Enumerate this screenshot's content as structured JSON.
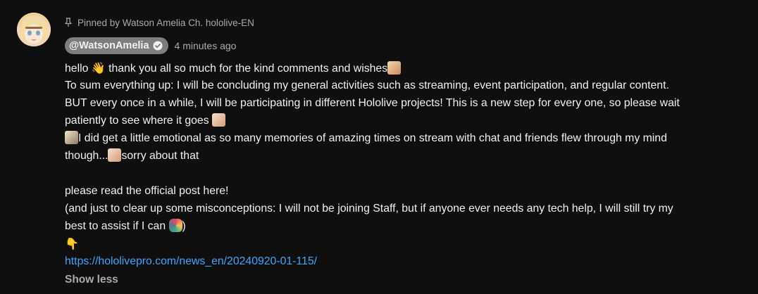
{
  "comment": {
    "pinned_label": "Pinned by Watson Amelia Ch. hololive-EN",
    "author_handle": "@WatsonAmelia",
    "timestamp": "4 minutes ago",
    "lines": [
      {
        "segments": [
          "hello ",
          "👋",
          " thank you all so much for the kind comments and wishes"
        ]
      },
      {
        "text": "To sum everything up: I will be concluding my general activities such as streaming, event participation, and regular content."
      },
      {
        "text": "BUT every once in a while, I will be participating in different Hololive projects! This is a new step for every one, so please wait"
      },
      {
        "text": "patiently to see where it goes "
      },
      {
        "text": "I did get a little emotional as so many memories of amazing times on stream with chat and friends flew through my mind"
      },
      {
        "before": "though...",
        "after": "sorry about that"
      },
      {
        "text": "please read the official post here!"
      },
      {
        "text": "(and just to clear up some misconceptions: I will not be joining Staff, but if anyone ever needs any tech help, I will still try my"
      },
      {
        "before": "best to assist if I can ",
        "after": ")"
      },
      {
        "emoji": "👇"
      }
    ],
    "link_text": "https://hololivepro.com/news_en/20240920-01-115/",
    "show_less_label": "Show less"
  },
  "icons": {
    "pin": "pin-icon",
    "verified": "verified-check-icon",
    "avatar": "avatar-image"
  }
}
